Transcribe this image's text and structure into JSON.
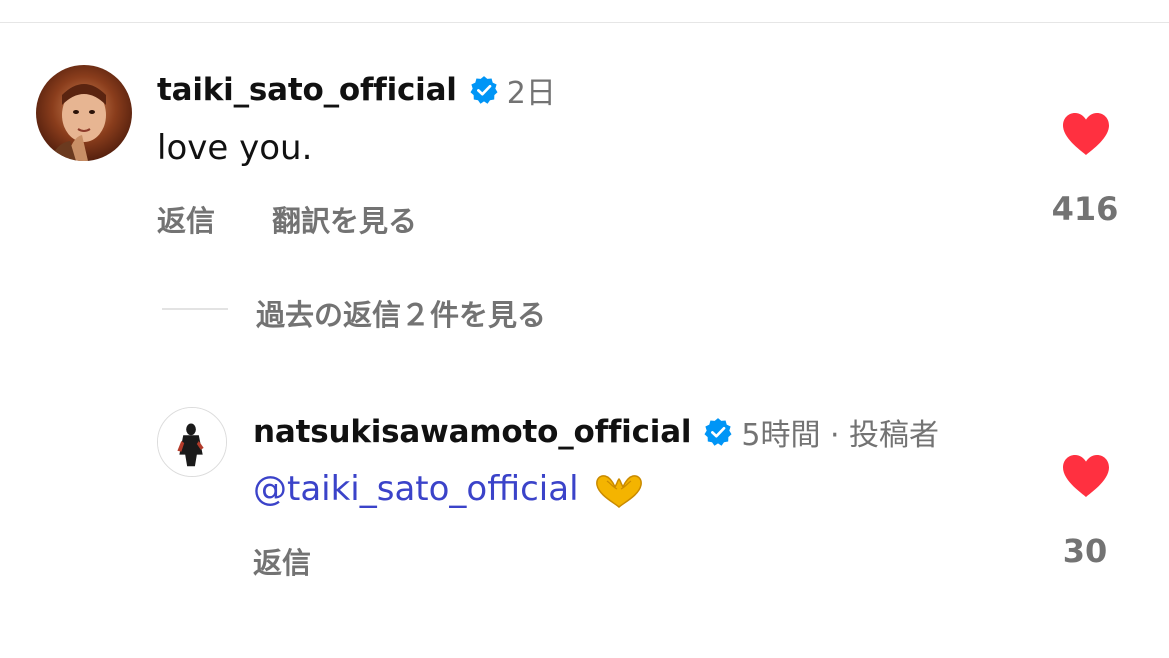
{
  "comment": {
    "username": "taiki_sato_official",
    "time": "2日",
    "text": "love you.",
    "reply_label": "返信",
    "translate_label": "翻訳を見る",
    "like_count": "416"
  },
  "view_replies": {
    "label": "過去の返信２件を見る"
  },
  "reply": {
    "username": "natsukisawamoto_official",
    "meta": "5時間 · 投稿者",
    "mention": "@taiki_sato_official",
    "emoji": "heart-hands-emoji",
    "reply_label": "返信",
    "like_count": "30"
  },
  "colors": {
    "verified_blue": "#0095f6",
    "heart_red": "#ff3040",
    "mention_blue": "#3b43c9",
    "muted_text": "#737373"
  },
  "icons": {
    "verified": "verified-badge-icon",
    "like": "heart-icon"
  }
}
